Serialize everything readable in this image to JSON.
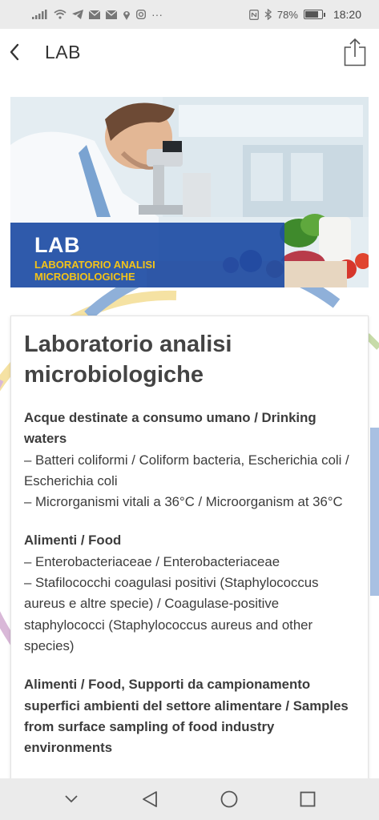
{
  "status_bar": {
    "battery_percent": "78%",
    "time": "18:20",
    "battery_level": 0.78,
    "left_icons": [
      "signal-icon",
      "wifi-icon",
      "telegram-icon",
      "mail-icon",
      "mail-icon",
      "location-icon",
      "instagram-icon",
      "more-icon"
    ],
    "right_icons": [
      "nfc-icon",
      "bluetooth-icon"
    ]
  },
  "app_bar": {
    "title": "LAB"
  },
  "banner": {
    "title": "LAB",
    "subtitle_line1": "LABORATORIO ANALISI",
    "subtitle_line2": "MICROBIOLOGICHE"
  },
  "card": {
    "title": "Laboratorio analisi microbiologiche",
    "sections": [
      {
        "heading": "Acque destinate a consumo umano / Drinking waters",
        "items": [
          "– Batteri coliformi / Coliform bacteria, Escherichia coli / Escherichia coli",
          "– Microrganismi vitali a 36°C / Microorganism at 36°C"
        ]
      },
      {
        "heading": "Alimenti / Food",
        "items": [
          "– Enterobacteriaceae / Enterobacteriaceae",
          "– Stafilococchi coagulasi positivi (Staphylococcus aureus e altre specie) / Coagulase-positive staphylococci (Staphylococcus aureus and other species)"
        ]
      },
      {
        "heading": "Alimenti / Food, Supporti da campionamento superfici ambienti del settore alimentare / Samples from surface sampling of food industry environments",
        "items": []
      }
    ]
  },
  "colors": {
    "banner_panel": "#1f4ea5",
    "banner_subtitle": "#f3c318"
  }
}
